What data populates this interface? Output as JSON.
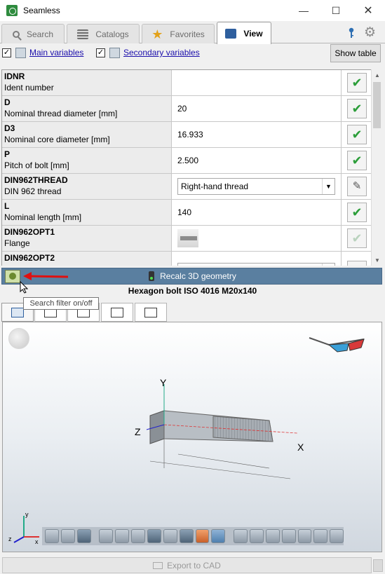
{
  "window": {
    "title": "Seamless",
    "minimize": "—",
    "maximize": "☐",
    "close": "✕"
  },
  "tabs": [
    {
      "label": "Search",
      "icon": "search-icon"
    },
    {
      "label": "Catalogs",
      "icon": "catalog-icon"
    },
    {
      "label": "Favorites",
      "icon": "star-icon"
    },
    {
      "label": "View",
      "icon": "view-icon",
      "active": true
    }
  ],
  "variables": {
    "main_label": "Main variables",
    "main_checked": true,
    "secondary_label": "Secondary variables",
    "secondary_checked": true,
    "show_table": "Show table"
  },
  "table": {
    "rows": [
      {
        "code": "IDNR",
        "desc": "Ident number",
        "value": "",
        "action": "check"
      },
      {
        "code": "D",
        "desc": "Nominal thread diameter [mm]",
        "value": "20",
        "action": "check"
      },
      {
        "code": "D3",
        "desc": "Nominal core diameter [mm]",
        "value": "16.933",
        "action": "check"
      },
      {
        "code": "P",
        "desc": "Pitch of bolt [mm]",
        "value": "2.500",
        "action": "check"
      },
      {
        "code": "DIN962THREAD",
        "desc": "DIN 962 thread",
        "value": "Right-hand thread",
        "action": "edit",
        "control": "dropdown"
      },
      {
        "code": "L",
        "desc": "Nominal length [mm]",
        "value": "140",
        "action": "check"
      },
      {
        "code": "DIN962OPT1",
        "desc": "Flange",
        "value": "",
        "action": "check-disabled",
        "control": "image"
      },
      {
        "code": "DIN962OPT2",
        "desc": "",
        "value": "-",
        "action": "edit",
        "control": "dropdown"
      }
    ]
  },
  "recalc": {
    "label": "Recalc 3D geometry"
  },
  "tooltip": "Search filter on/off",
  "part_title": "Hexagon bolt ISO 4016 M20x140",
  "axes": {
    "x": "X",
    "y": "Y",
    "z": "Z"
  },
  "export": {
    "label": "Export to CAD"
  },
  "colors": {
    "accent": "#5a7fa0",
    "check_green": "#2c9e3a",
    "arrow_red": "#e01010"
  }
}
